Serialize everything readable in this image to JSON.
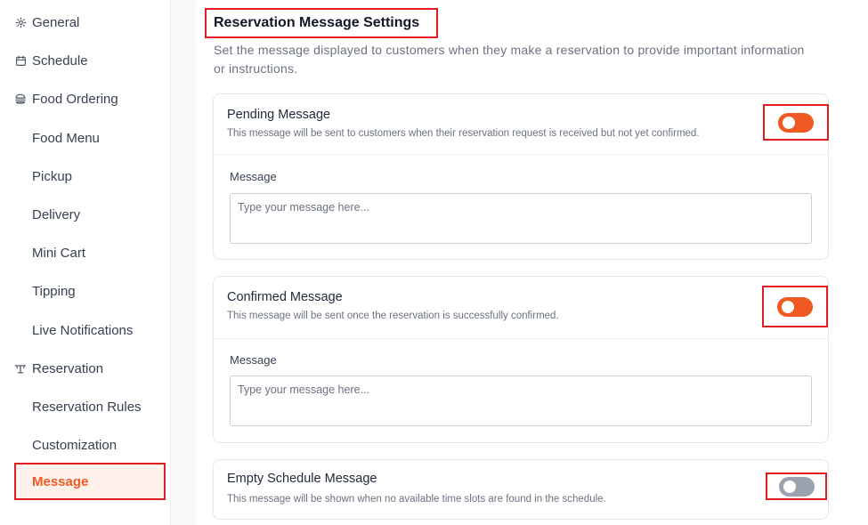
{
  "sidebar": {
    "items": [
      {
        "label": "General",
        "icon": "gear-icon"
      },
      {
        "label": "Schedule",
        "icon": "calendar-icon"
      },
      {
        "label": "Food Ordering",
        "icon": "burger-icon"
      },
      {
        "label": "Food Menu"
      },
      {
        "label": "Pickup"
      },
      {
        "label": "Delivery"
      },
      {
        "label": "Mini Cart"
      },
      {
        "label": "Tipping"
      },
      {
        "label": "Live Notifications"
      },
      {
        "label": "Reservation",
        "icon": "table-icon"
      },
      {
        "label": "Reservation Rules"
      },
      {
        "label": "Customization"
      },
      {
        "label": "Message",
        "active": true
      }
    ]
  },
  "main": {
    "title": "Reservation Message Settings",
    "description": "Set the message displayed to customers when they make a reservation to provide important information or instructions.",
    "cards": [
      {
        "title": "Pending Message",
        "subtitle": "This message will be sent to customers when their reservation request is received but not yet confirmed.",
        "enabled": true,
        "message_label": "Message",
        "placeholder": "Type your message here..."
      },
      {
        "title": "Confirmed Message",
        "subtitle": "This message will be sent once the reservation is successfully confirmed.",
        "enabled": true,
        "message_label": "Message",
        "placeholder": "Type your message here..."
      },
      {
        "title": "Empty Schedule Message",
        "subtitle": "This message will be shown when no available time slots are found in the schedule.",
        "enabled": false
      }
    ]
  },
  "colors": {
    "accent": "#f05a22",
    "highlight_border": "#e11d24",
    "toggle_off": "#9ca3af"
  }
}
